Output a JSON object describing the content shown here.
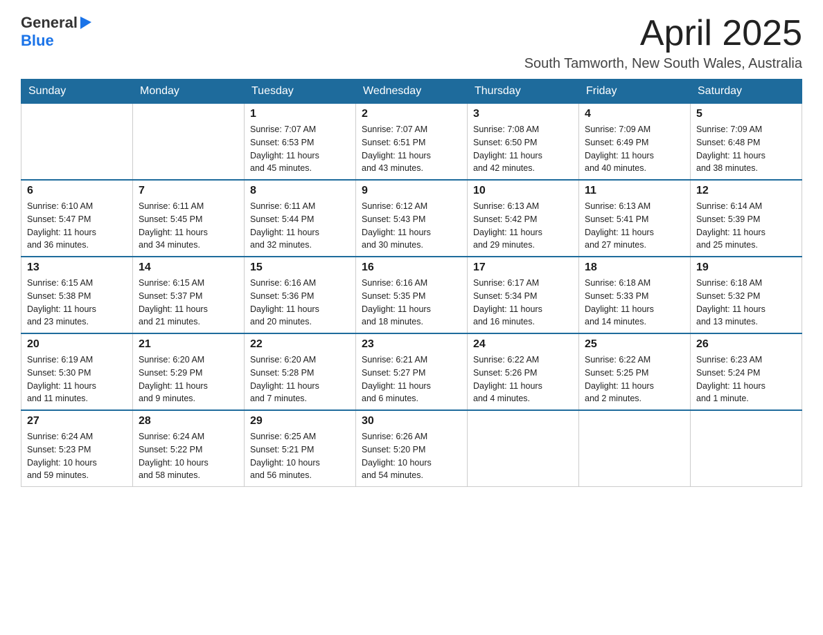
{
  "header": {
    "logo_general": "General",
    "logo_blue": "Blue",
    "month_year": "April 2025",
    "location": "South Tamworth, New South Wales, Australia"
  },
  "days_of_week": [
    "Sunday",
    "Monday",
    "Tuesday",
    "Wednesday",
    "Thursday",
    "Friday",
    "Saturday"
  ],
  "weeks": [
    [
      {
        "day": "",
        "info": ""
      },
      {
        "day": "",
        "info": ""
      },
      {
        "day": "1",
        "info": "Sunrise: 7:07 AM\nSunset: 6:53 PM\nDaylight: 11 hours\nand 45 minutes."
      },
      {
        "day": "2",
        "info": "Sunrise: 7:07 AM\nSunset: 6:51 PM\nDaylight: 11 hours\nand 43 minutes."
      },
      {
        "day": "3",
        "info": "Sunrise: 7:08 AM\nSunset: 6:50 PM\nDaylight: 11 hours\nand 42 minutes."
      },
      {
        "day": "4",
        "info": "Sunrise: 7:09 AM\nSunset: 6:49 PM\nDaylight: 11 hours\nand 40 minutes."
      },
      {
        "day": "5",
        "info": "Sunrise: 7:09 AM\nSunset: 6:48 PM\nDaylight: 11 hours\nand 38 minutes."
      }
    ],
    [
      {
        "day": "6",
        "info": "Sunrise: 6:10 AM\nSunset: 5:47 PM\nDaylight: 11 hours\nand 36 minutes."
      },
      {
        "day": "7",
        "info": "Sunrise: 6:11 AM\nSunset: 5:45 PM\nDaylight: 11 hours\nand 34 minutes."
      },
      {
        "day": "8",
        "info": "Sunrise: 6:11 AM\nSunset: 5:44 PM\nDaylight: 11 hours\nand 32 minutes."
      },
      {
        "day": "9",
        "info": "Sunrise: 6:12 AM\nSunset: 5:43 PM\nDaylight: 11 hours\nand 30 minutes."
      },
      {
        "day": "10",
        "info": "Sunrise: 6:13 AM\nSunset: 5:42 PM\nDaylight: 11 hours\nand 29 minutes."
      },
      {
        "day": "11",
        "info": "Sunrise: 6:13 AM\nSunset: 5:41 PM\nDaylight: 11 hours\nand 27 minutes."
      },
      {
        "day": "12",
        "info": "Sunrise: 6:14 AM\nSunset: 5:39 PM\nDaylight: 11 hours\nand 25 minutes."
      }
    ],
    [
      {
        "day": "13",
        "info": "Sunrise: 6:15 AM\nSunset: 5:38 PM\nDaylight: 11 hours\nand 23 minutes."
      },
      {
        "day": "14",
        "info": "Sunrise: 6:15 AM\nSunset: 5:37 PM\nDaylight: 11 hours\nand 21 minutes."
      },
      {
        "day": "15",
        "info": "Sunrise: 6:16 AM\nSunset: 5:36 PM\nDaylight: 11 hours\nand 20 minutes."
      },
      {
        "day": "16",
        "info": "Sunrise: 6:16 AM\nSunset: 5:35 PM\nDaylight: 11 hours\nand 18 minutes."
      },
      {
        "day": "17",
        "info": "Sunrise: 6:17 AM\nSunset: 5:34 PM\nDaylight: 11 hours\nand 16 minutes."
      },
      {
        "day": "18",
        "info": "Sunrise: 6:18 AM\nSunset: 5:33 PM\nDaylight: 11 hours\nand 14 minutes."
      },
      {
        "day": "19",
        "info": "Sunrise: 6:18 AM\nSunset: 5:32 PM\nDaylight: 11 hours\nand 13 minutes."
      }
    ],
    [
      {
        "day": "20",
        "info": "Sunrise: 6:19 AM\nSunset: 5:30 PM\nDaylight: 11 hours\nand 11 minutes."
      },
      {
        "day": "21",
        "info": "Sunrise: 6:20 AM\nSunset: 5:29 PM\nDaylight: 11 hours\nand 9 minutes."
      },
      {
        "day": "22",
        "info": "Sunrise: 6:20 AM\nSunset: 5:28 PM\nDaylight: 11 hours\nand 7 minutes."
      },
      {
        "day": "23",
        "info": "Sunrise: 6:21 AM\nSunset: 5:27 PM\nDaylight: 11 hours\nand 6 minutes."
      },
      {
        "day": "24",
        "info": "Sunrise: 6:22 AM\nSunset: 5:26 PM\nDaylight: 11 hours\nand 4 minutes."
      },
      {
        "day": "25",
        "info": "Sunrise: 6:22 AM\nSunset: 5:25 PM\nDaylight: 11 hours\nand 2 minutes."
      },
      {
        "day": "26",
        "info": "Sunrise: 6:23 AM\nSunset: 5:24 PM\nDaylight: 11 hours\nand 1 minute."
      }
    ],
    [
      {
        "day": "27",
        "info": "Sunrise: 6:24 AM\nSunset: 5:23 PM\nDaylight: 10 hours\nand 59 minutes."
      },
      {
        "day": "28",
        "info": "Sunrise: 6:24 AM\nSunset: 5:22 PM\nDaylight: 10 hours\nand 58 minutes."
      },
      {
        "day": "29",
        "info": "Sunrise: 6:25 AM\nSunset: 5:21 PM\nDaylight: 10 hours\nand 56 minutes."
      },
      {
        "day": "30",
        "info": "Sunrise: 6:26 AM\nSunset: 5:20 PM\nDaylight: 10 hours\nand 54 minutes."
      },
      {
        "day": "",
        "info": ""
      },
      {
        "day": "",
        "info": ""
      },
      {
        "day": "",
        "info": ""
      }
    ]
  ]
}
